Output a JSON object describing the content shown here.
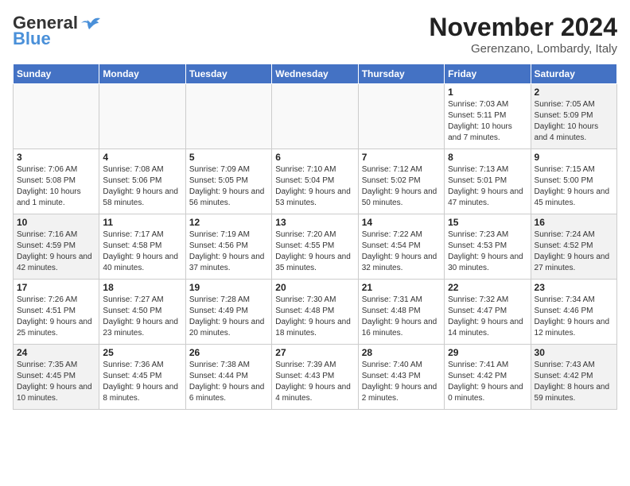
{
  "header": {
    "logo_general": "General",
    "logo_blue": "Blue",
    "month_title": "November 2024",
    "location": "Gerenzano, Lombardy, Italy"
  },
  "weekdays": [
    "Sunday",
    "Monday",
    "Tuesday",
    "Wednesday",
    "Thursday",
    "Friday",
    "Saturday"
  ],
  "weeks": [
    [
      {
        "day": "",
        "empty": true,
        "info": ""
      },
      {
        "day": "",
        "empty": true,
        "info": ""
      },
      {
        "day": "",
        "empty": true,
        "info": ""
      },
      {
        "day": "",
        "empty": true,
        "info": ""
      },
      {
        "day": "",
        "empty": true,
        "info": ""
      },
      {
        "day": "1",
        "info": "Sunrise: 7:03 AM\nSunset: 5:11 PM\nDaylight: 10 hours and 7 minutes."
      },
      {
        "day": "2",
        "info": "Sunrise: 7:05 AM\nSunset: 5:09 PM\nDaylight: 10 hours and 4 minutes."
      }
    ],
    [
      {
        "day": "3",
        "info": "Sunrise: 7:06 AM\nSunset: 5:08 PM\nDaylight: 10 hours and 1 minute."
      },
      {
        "day": "4",
        "info": "Sunrise: 7:08 AM\nSunset: 5:06 PM\nDaylight: 9 hours and 58 minutes."
      },
      {
        "day": "5",
        "info": "Sunrise: 7:09 AM\nSunset: 5:05 PM\nDaylight: 9 hours and 56 minutes."
      },
      {
        "day": "6",
        "info": "Sunrise: 7:10 AM\nSunset: 5:04 PM\nDaylight: 9 hours and 53 minutes."
      },
      {
        "day": "7",
        "info": "Sunrise: 7:12 AM\nSunset: 5:02 PM\nDaylight: 9 hours and 50 minutes."
      },
      {
        "day": "8",
        "info": "Sunrise: 7:13 AM\nSunset: 5:01 PM\nDaylight: 9 hours and 47 minutes."
      },
      {
        "day": "9",
        "info": "Sunrise: 7:15 AM\nSunset: 5:00 PM\nDaylight: 9 hours and 45 minutes."
      }
    ],
    [
      {
        "day": "10",
        "info": "Sunrise: 7:16 AM\nSunset: 4:59 PM\nDaylight: 9 hours and 42 minutes."
      },
      {
        "day": "11",
        "info": "Sunrise: 7:17 AM\nSunset: 4:58 PM\nDaylight: 9 hours and 40 minutes."
      },
      {
        "day": "12",
        "info": "Sunrise: 7:19 AM\nSunset: 4:56 PM\nDaylight: 9 hours and 37 minutes."
      },
      {
        "day": "13",
        "info": "Sunrise: 7:20 AM\nSunset: 4:55 PM\nDaylight: 9 hours and 35 minutes."
      },
      {
        "day": "14",
        "info": "Sunrise: 7:22 AM\nSunset: 4:54 PM\nDaylight: 9 hours and 32 minutes."
      },
      {
        "day": "15",
        "info": "Sunrise: 7:23 AM\nSunset: 4:53 PM\nDaylight: 9 hours and 30 minutes."
      },
      {
        "day": "16",
        "info": "Sunrise: 7:24 AM\nSunset: 4:52 PM\nDaylight: 9 hours and 27 minutes."
      }
    ],
    [
      {
        "day": "17",
        "info": "Sunrise: 7:26 AM\nSunset: 4:51 PM\nDaylight: 9 hours and 25 minutes."
      },
      {
        "day": "18",
        "info": "Sunrise: 7:27 AM\nSunset: 4:50 PM\nDaylight: 9 hours and 23 minutes."
      },
      {
        "day": "19",
        "info": "Sunrise: 7:28 AM\nSunset: 4:49 PM\nDaylight: 9 hours and 20 minutes."
      },
      {
        "day": "20",
        "info": "Sunrise: 7:30 AM\nSunset: 4:48 PM\nDaylight: 9 hours and 18 minutes."
      },
      {
        "day": "21",
        "info": "Sunrise: 7:31 AM\nSunset: 4:48 PM\nDaylight: 9 hours and 16 minutes."
      },
      {
        "day": "22",
        "info": "Sunrise: 7:32 AM\nSunset: 4:47 PM\nDaylight: 9 hours and 14 minutes."
      },
      {
        "day": "23",
        "info": "Sunrise: 7:34 AM\nSunset: 4:46 PM\nDaylight: 9 hours and 12 minutes."
      }
    ],
    [
      {
        "day": "24",
        "info": "Sunrise: 7:35 AM\nSunset: 4:45 PM\nDaylight: 9 hours and 10 minutes."
      },
      {
        "day": "25",
        "info": "Sunrise: 7:36 AM\nSunset: 4:45 PM\nDaylight: 9 hours and 8 minutes."
      },
      {
        "day": "26",
        "info": "Sunrise: 7:38 AM\nSunset: 4:44 PM\nDaylight: 9 hours and 6 minutes."
      },
      {
        "day": "27",
        "info": "Sunrise: 7:39 AM\nSunset: 4:43 PM\nDaylight: 9 hours and 4 minutes."
      },
      {
        "day": "28",
        "info": "Sunrise: 7:40 AM\nSunset: 4:43 PM\nDaylight: 9 hours and 2 minutes."
      },
      {
        "day": "29",
        "info": "Sunrise: 7:41 AM\nSunset: 4:42 PM\nDaylight: 9 hours and 0 minutes."
      },
      {
        "day": "30",
        "info": "Sunrise: 7:43 AM\nSunset: 4:42 PM\nDaylight: 8 hours and 59 minutes."
      }
    ]
  ]
}
